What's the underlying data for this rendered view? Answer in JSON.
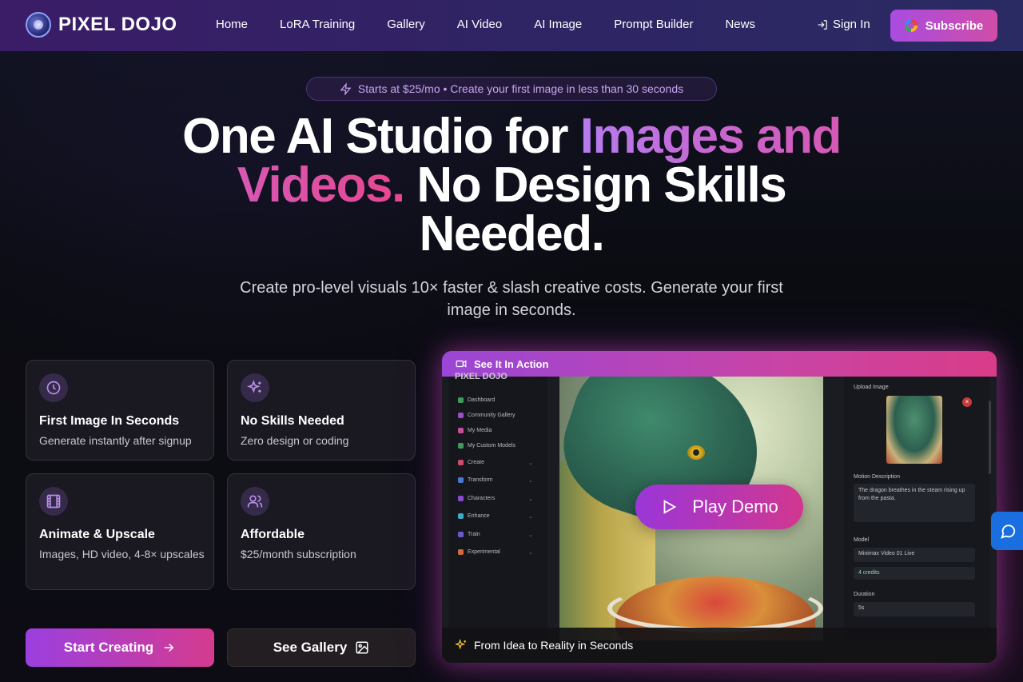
{
  "nav": {
    "logo_text": "PIXEL DOJO",
    "links": [
      "Home",
      "LoRA Training",
      "Gallery",
      "AI Video",
      "AI Image",
      "Prompt Builder",
      "News"
    ],
    "sign_in": "Sign In",
    "subscribe": "Subscribe"
  },
  "hero": {
    "pill": "Starts at $25/mo • Create your first image in less than 30 seconds",
    "headline_part1": "One AI Studio for ",
    "headline_grad": "Images and Videos.",
    "headline_part2": " No Design Skills Needed.",
    "subhead": "Create pro-level visuals 10× faster & slash creative costs. Generate your first image in seconds."
  },
  "features": [
    {
      "title": "First Image In Seconds",
      "desc": "Generate instantly after signup",
      "icon": "clock-icon"
    },
    {
      "title": "No Skills Needed",
      "desc": "Zero design or coding",
      "icon": "sparkles-icon"
    },
    {
      "title": "Animate & Upscale",
      "desc": "Images, HD video, 4-8× upscales",
      "icon": "film-icon"
    },
    {
      "title": "Affordable",
      "desc": "$25/month subscription",
      "icon": "users-icon"
    }
  ],
  "cta": {
    "start": "Start Creating",
    "gallery": "See Gallery"
  },
  "demo": {
    "header": "See It In Action",
    "play": "Play Demo",
    "footer": "From Idea to Reality in Seconds",
    "app_logo": "PIXEL DOJO",
    "sidebar": [
      "Dashboard",
      "Community Gallery",
      "My Media",
      "My Custom Models",
      "Create",
      "Transform",
      "Characters",
      "Enhance",
      "Train",
      "Experimental"
    ],
    "right": {
      "upload_label": "Upload Image",
      "motion_label": "Motion Description",
      "motion_text": "The dragon breathes in the steam rising up from the pasta.",
      "model_label": "Model",
      "model_value": "Minimax Video 01 Live",
      "credits": "4 credits",
      "duration_label": "Duration",
      "duration_value": "5s"
    }
  },
  "colors": {
    "accent_purple": "#9b3fe0",
    "accent_pink": "#d53b8e",
    "chat_blue": "#1a6fe0"
  }
}
